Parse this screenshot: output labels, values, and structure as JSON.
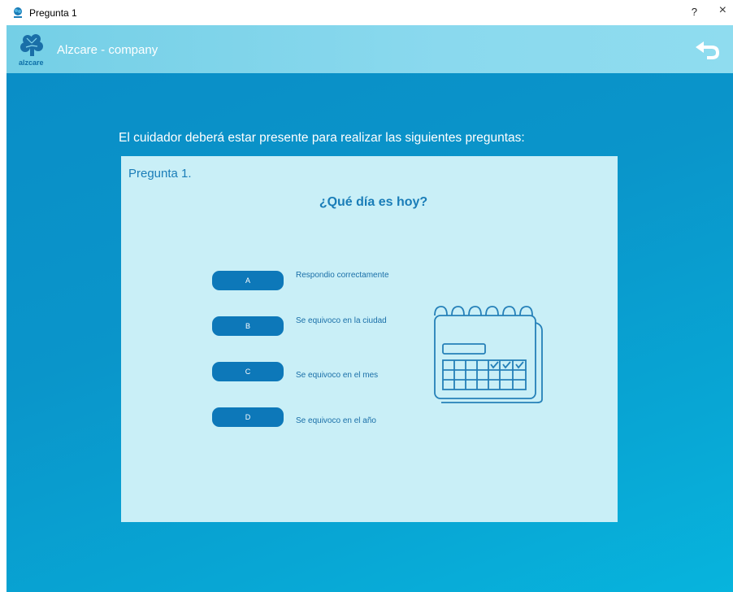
{
  "window": {
    "title": "Pregunta 1",
    "help_label": "?",
    "close_label": "×"
  },
  "header": {
    "logo_text": "alzcare",
    "company_name": "Alzcare - company",
    "back_icon": "back-arrow-icon"
  },
  "main": {
    "instruction": "El cuidador deberá estar presente para realizar las siguientes preguntas:",
    "question_number": "Pregunta 1.",
    "question_text": "¿Qué día es hoy?",
    "options": [
      {
        "letter": "A",
        "label": "Respondio correctamente"
      },
      {
        "letter": "B",
        "label": "Se equivoco en la ciudad"
      },
      {
        "letter": "C",
        "label": "Se equivoco en el mes"
      },
      {
        "letter": "D",
        "label": "Se equivoco en el año"
      }
    ],
    "illustration": "calendar-icon"
  },
  "colors": {
    "appbar": "#8ad9ee",
    "background": "#0a95ca",
    "panel": "#c9eff7",
    "button": "#0d78b9",
    "accent_text": "#1a7db8"
  }
}
